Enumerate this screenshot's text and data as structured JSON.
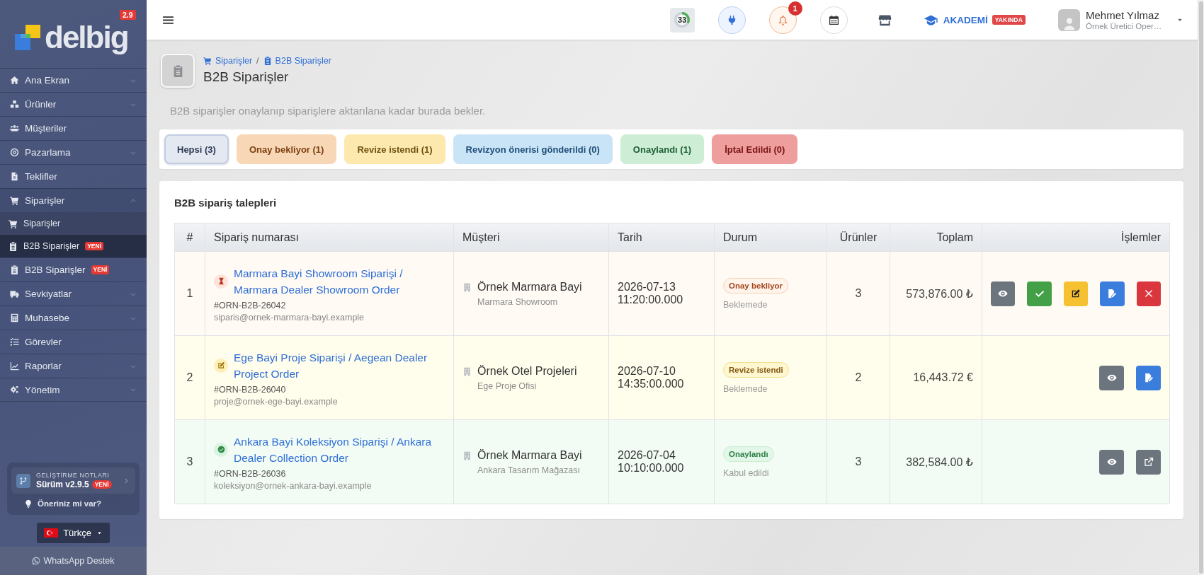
{
  "sidebar": {
    "logo": {
      "text": "delbig",
      "version": "2.9"
    },
    "items": [
      {
        "label": "Ana Ekran",
        "kind": "group",
        "expanded": false,
        "selected": false
      },
      {
        "label": "Ürünler",
        "kind": "group",
        "expanded": false,
        "selected": false
      },
      {
        "label": "Müşteriler",
        "kind": "link",
        "selected": false
      },
      {
        "label": "Pazarlama",
        "kind": "group",
        "expanded": false,
        "selected": false
      },
      {
        "label": "Teklifler",
        "kind": "link",
        "selected": false
      },
      {
        "label": "Siparişler",
        "kind": "group",
        "expanded": true,
        "selected": false,
        "children": [
          {
            "label": "Siparişler",
            "selected": false
          },
          {
            "label": "B2B Siparişler",
            "badge": "YENİ",
            "selected": true
          }
        ]
      },
      {
        "label": "B2B Siparişler",
        "kind": "link",
        "badge": "YENİ",
        "selected": false
      },
      {
        "label": "Sevkiyatlar",
        "kind": "group",
        "expanded": false,
        "selected": false
      },
      {
        "label": "Muhasebe",
        "kind": "group",
        "expanded": false,
        "selected": false
      },
      {
        "label": "Görevler",
        "kind": "link",
        "selected": false
      },
      {
        "label": "Raporlar",
        "kind": "group",
        "expanded": false,
        "selected": false
      },
      {
        "label": "Yönetim",
        "kind": "group",
        "expanded": false,
        "selected": false
      }
    ],
    "release_notes": {
      "caption": "GELİŞTİRME NOTLARI",
      "version": "Sürüm v2.9.5",
      "badge": "YENİ"
    },
    "suggestion": "Öneriniz mi var?",
    "language": "Türkçe",
    "support": "WhatsApp Destek"
  },
  "topbar": {
    "progress": {
      "text": "33",
      "level": 0.33
    },
    "notifications": {
      "count": "1"
    },
    "academy": {
      "label": "AKADEMİ",
      "badge": "YAKINDA"
    },
    "user": {
      "name": "Mehmet Yılmaz",
      "role": "Örnek Üretici Oper…"
    }
  },
  "page": {
    "breadcrumb": {
      "items": [
        "Siparişler",
        "B2B Siparişler"
      ],
      "separator": "/"
    },
    "title": "B2B Siparişler",
    "description": "B2B siparişler onaylanıp siparişlere aktarılana kadar burada bekler."
  },
  "filters": [
    {
      "label": "Hepsi (3)",
      "kind": "all",
      "selected": true
    },
    {
      "label": "Onay bekliyor (1)",
      "kind": "pending",
      "selected": false
    },
    {
      "label": "Revize istendi (1)",
      "kind": "revision",
      "selected": false
    },
    {
      "label": "Revizyon önerisi gönderildi (0)",
      "kind": "proposal",
      "selected": false
    },
    {
      "label": "Onaylandı (1)",
      "kind": "approved",
      "selected": false
    },
    {
      "label": "İptal Edildi (0)",
      "kind": "cancelled",
      "selected": false
    }
  ],
  "table": {
    "title": "B2B sipariş talepleri",
    "columns": [
      "#",
      "Sipariş numarası",
      "Müşteri",
      "Tarih",
      "Durum",
      "Ürünler",
      "Toplam",
      "İşlemler"
    ],
    "rows": [
      {
        "index": "1",
        "title": "Marmara Bayi Showroom Siparişi / Marmara Dealer Showroom Order",
        "code": "#ORN-B2B-26042",
        "email": "siparis@ornek-marmara-bayi.example",
        "customer": "Örnek Marmara Bayi",
        "branch": "Marmara Showroom",
        "date": "2026-07-13 11:20:00.000",
        "status": {
          "kind": "pending",
          "label": "Onay bekliyor",
          "note": "Beklemede"
        },
        "items": "3",
        "total": "573,876.00 ₺",
        "actions": [
          {
            "kind": "view"
          },
          {
            "kind": "approve"
          },
          {
            "kind": "edit"
          },
          {
            "kind": "revise"
          },
          {
            "kind": "reject"
          }
        ]
      },
      {
        "index": "2",
        "title": "Ege Bayi Proje Siparişi / Aegean Dealer Project Order",
        "code": "#ORN-B2B-26040",
        "email": "proje@ornek-ege-bayi.example",
        "customer": "Örnek Otel Projeleri",
        "branch": "Ege Proje Ofisi",
        "date": "2026-07-10 14:35:00.000",
        "status": {
          "kind": "revision",
          "label": "Revize istendi",
          "note": "Beklemede"
        },
        "items": "2",
        "total": "16,443.72 €",
        "actions": [
          {
            "kind": "view"
          },
          {
            "kind": "revise"
          }
        ]
      },
      {
        "index": "3",
        "title": "Ankara Bayi Koleksiyon Siparişi / Ankara Dealer Collection Order",
        "code": "#ORN-B2B-26036",
        "email": "koleksiyon@ornek-ankara-bayi.example",
        "customer": "Örnek Marmara Bayi",
        "branch": "Ankara Tasarım Mağazası",
        "date": "2026-07-04 10:10:00.000",
        "status": {
          "kind": "approved",
          "label": "Onaylandı",
          "note": "Kabul edildi"
        },
        "items": "3",
        "total": "382,584.00 ₺",
        "actions": [
          {
            "kind": "view"
          },
          {
            "kind": "open"
          }
        ]
      }
    ]
  }
}
